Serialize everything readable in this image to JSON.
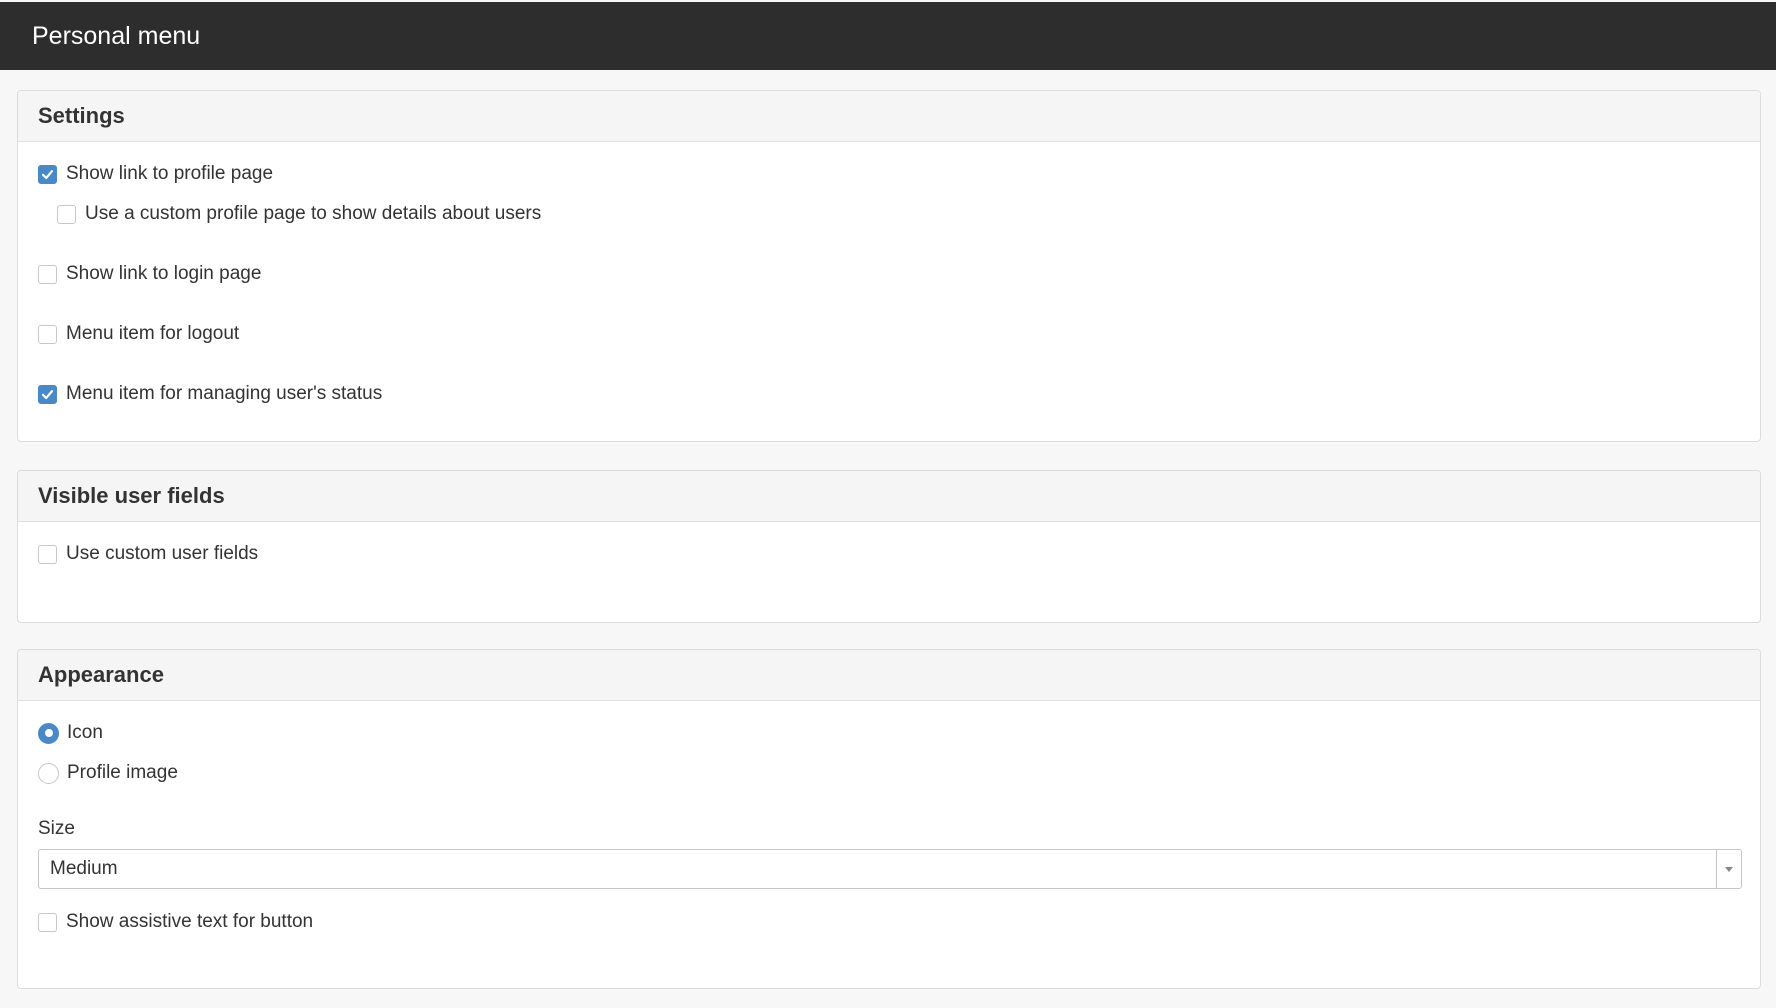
{
  "header": {
    "title": "Personal menu"
  },
  "settings": {
    "heading": "Settings",
    "options": [
      {
        "label": "Show link to profile page",
        "checked": true
      },
      {
        "label": "Use a custom profile page to show details about users",
        "checked": false
      },
      {
        "label": "Show link to login page",
        "checked": false
      },
      {
        "label": "Menu item for logout",
        "checked": false
      },
      {
        "label": "Menu item for managing user's status",
        "checked": true
      }
    ]
  },
  "visible_user_fields": {
    "heading": "Visible user fields",
    "options": [
      {
        "label": "Use custom user fields",
        "checked": false
      }
    ]
  },
  "appearance": {
    "heading": "Appearance",
    "radios": [
      {
        "label": "Icon",
        "selected": true
      },
      {
        "label": "Profile image",
        "selected": false
      }
    ],
    "size_label": "Size",
    "size_value": "Medium",
    "assistive": {
      "label": "Show assistive text for button",
      "checked": false
    }
  },
  "colors": {
    "topbar": "#2d2d2d",
    "accent": "#4a89c8",
    "panel_header": "#f5f5f5"
  },
  "icons": {
    "check": "checkmark-icon",
    "dropdown": "caret-down-icon"
  }
}
